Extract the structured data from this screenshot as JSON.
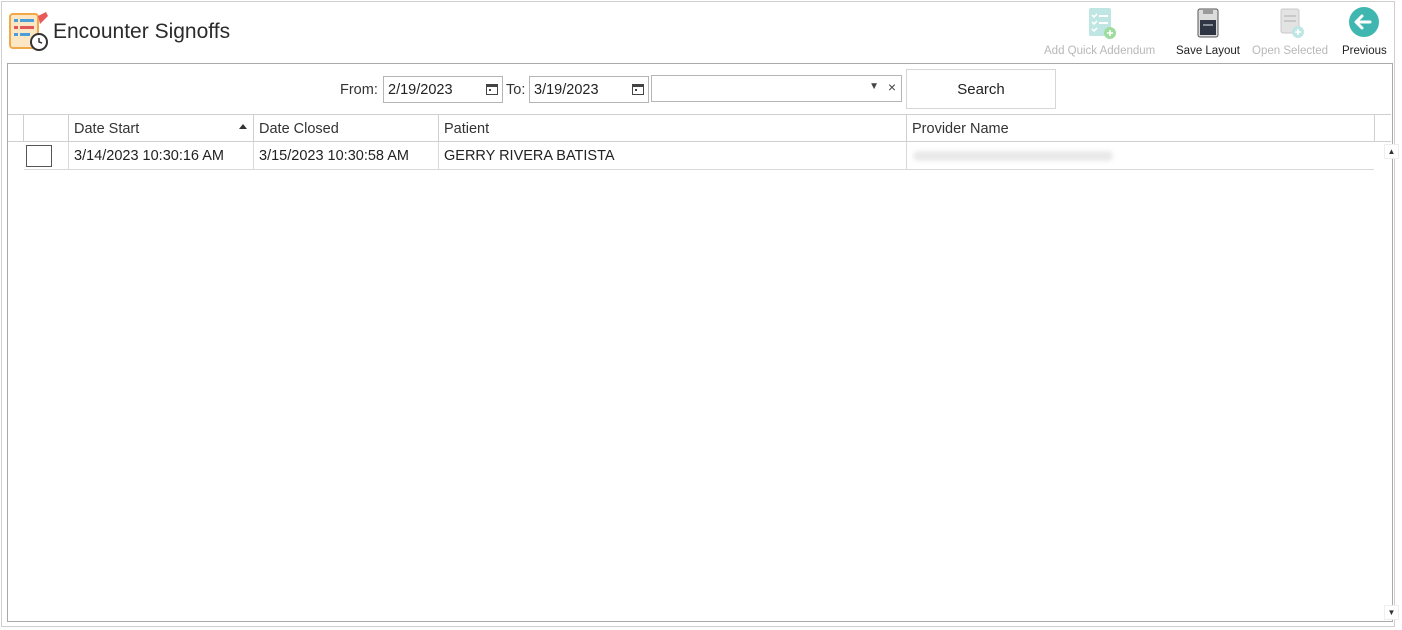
{
  "window": {
    "title": "Encounter Signoffs"
  },
  "toolbar": {
    "add_quick_addendum": "Add Quick Addendum",
    "save_layout": "Save Layout",
    "open_selected": "Open Selected",
    "previous": "Previous"
  },
  "filters": {
    "from_label": "From:",
    "from_value": "2/19/2023",
    "to_label": "To:",
    "to_value": "3/19/2023",
    "combo_value": "",
    "search_label": "Search"
  },
  "grid": {
    "columns": [
      "Date Start",
      "Date Closed",
      "Patient",
      "Provider Name"
    ],
    "sort_column": "Date Start",
    "sort_direction": "ascending",
    "rows": [
      {
        "date_start": "3/14/2023 10:30:16 AM",
        "date_closed": "3/15/2023 10:30:58 AM",
        "patient": "GERRY RIVERA BATISTA",
        "provider": ""
      }
    ]
  },
  "colors": {
    "accent": "#3fb7b0",
    "disabled_text": "#b8b8b8",
    "border": "#a9a9a9"
  }
}
